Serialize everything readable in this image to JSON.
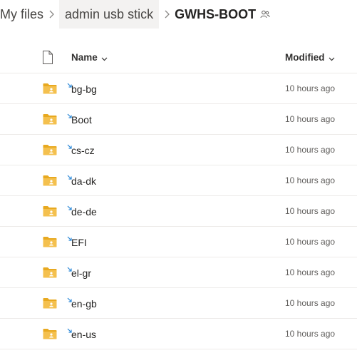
{
  "breadcrumb": {
    "root": "My files",
    "parent": "admin usb stick",
    "current": "GWHS-BOOT"
  },
  "columns": {
    "name": "Name",
    "modified": "Modified"
  },
  "rows": [
    {
      "name": "bg-bg",
      "modified": "10 hours ago"
    },
    {
      "name": "Boot",
      "modified": "10 hours ago"
    },
    {
      "name": "cs-cz",
      "modified": "10 hours ago"
    },
    {
      "name": "da-dk",
      "modified": "10 hours ago"
    },
    {
      "name": "de-de",
      "modified": "10 hours ago"
    },
    {
      "name": "EFI",
      "modified": "10 hours ago"
    },
    {
      "name": "el-gr",
      "modified": "10 hours ago"
    },
    {
      "name": "en-gb",
      "modified": "10 hours ago"
    },
    {
      "name": "en-us",
      "modified": "10 hours ago"
    }
  ],
  "icons": {
    "header_file": "file-icon",
    "folder": "shared-folder-icon",
    "sync": "sync-icon",
    "shared": "shared-people-icon",
    "separator": "chevron-right-icon",
    "sort": "chevron-down-icon"
  },
  "colors": {
    "folder": "#f4c04e",
    "folder_tab": "#e8a920",
    "sync": "#2b88d8",
    "divider": "#edebe9",
    "hover_bg": "#f3f2f1"
  }
}
